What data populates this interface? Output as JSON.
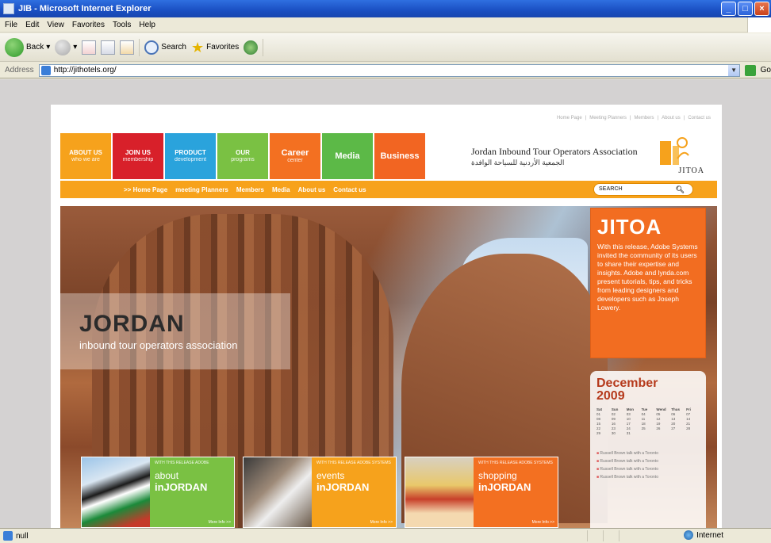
{
  "window": {
    "title": "JIB - Microsoft Internet Explorer"
  },
  "menu": [
    "File",
    "Edit",
    "View",
    "Favorites",
    "Tools",
    "Help"
  ],
  "toolbar": {
    "back": "Back",
    "search": "Search",
    "favorites": "Favorites"
  },
  "address": {
    "label": "Address",
    "url": "http://jithotels.org/",
    "go": "Go"
  },
  "site": {
    "toplinks": [
      "Home Page",
      "Meeting Planners",
      "Members",
      "About us",
      "Contact us"
    ],
    "nav": [
      {
        "line1": "ABOUT US",
        "line2": "who we are",
        "color": "#f6a21c"
      },
      {
        "line1": "JOIN US",
        "line2": "membership",
        "color": "#d8202a"
      },
      {
        "line1": "PRODUCT",
        "line2": "development",
        "color": "#2aa3dc"
      },
      {
        "line1": "OUR",
        "line2": "programs",
        "color": "#7ac143"
      },
      {
        "line1": "Career",
        "line2": "center",
        "color": "#f37021"
      },
      {
        "line1": "Media",
        "line2": "",
        "color": "#5cb947"
      },
      {
        "line1": "Business",
        "line2": "",
        "color": "#f26522"
      }
    ],
    "brand": {
      "name": "Jordan Inbound Tour Operators Association",
      "arabic": "الجمعية الأردنية للسياحة الوافدة",
      "abbr": "JITOA"
    },
    "subnav": [
      ">> Home Page",
      "meeting Planners",
      "Members",
      "Media",
      "About us",
      "Contact us"
    ],
    "search_placeholder": "SEARCH",
    "hero": {
      "title": "JORDAN",
      "subtitle": "inbound tour operators association"
    },
    "jitoa": {
      "title": "JITOA",
      "text": "With this release, Adobe Systems invited the community of its users to share their expertise and insights. Adobe and lynda.com present tutorials, tips, and tricks from leading designers and developers such as Joseph Lowery."
    },
    "calendar": {
      "month": "December",
      "year": "2009",
      "days": [
        "Sat",
        "Sun",
        "Mon",
        "Tue",
        "Wend",
        "Thus",
        "Fri"
      ],
      "dates": [
        "01",
        "02",
        "03",
        "04",
        "05",
        "06",
        "07",
        "08",
        "09",
        "10",
        "11",
        "12",
        "13",
        "14",
        "15",
        "16",
        "17",
        "18",
        "19",
        "20",
        "21",
        "22",
        "23",
        "24",
        "25",
        "26",
        "27",
        "28",
        "29",
        "30",
        "31"
      ],
      "events": [
        "Russell Brown talk with a Toronto",
        "Russell Brown talk with a Toronto",
        "Russell Brown talk with a Toronto",
        "Russell Brown talk with a Toronto"
      ]
    },
    "promos": [
      {
        "small": "WITH THIS RELEASE ADOBE",
        "w1": "about",
        "w2": "inJORDAN",
        "more": "More Info >>",
        "color": "#7ac143"
      },
      {
        "small": "WITH THIS RELEASE ADOBE SYSTEMS",
        "w1": "events",
        "w2": "inJORDAN",
        "more": "More Info >>",
        "color": "#f6a21c"
      },
      {
        "small": "WITH THIS RELEASE ADOBE SYSTEMS",
        "w1": "shopping",
        "w2": "inJORDAN",
        "more": "More Info >>",
        "color": "#f37021"
      }
    ]
  },
  "status": {
    "text": "null",
    "zone": "Internet"
  }
}
